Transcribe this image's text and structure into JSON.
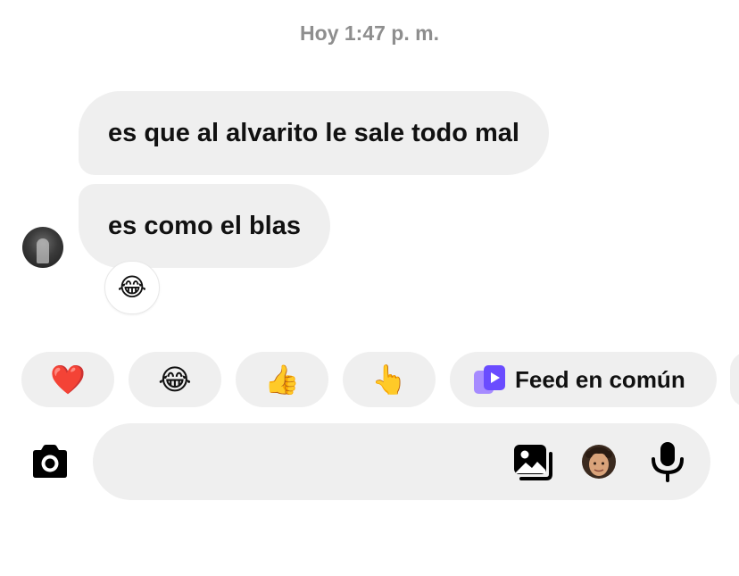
{
  "header": {
    "timestamp": "Hoy 1:47 p. m."
  },
  "messages": [
    {
      "text": "es que al alvarito le sale todo mal",
      "direction": "incoming"
    },
    {
      "text": "es como el blas",
      "direction": "incoming"
    }
  ],
  "reaction": {
    "emoji": "😂",
    "icon": "face-with-tears-of-joy-icon"
  },
  "quick_replies": {
    "items": [
      {
        "emoji": "❤️",
        "icon": "red-heart-icon"
      },
      {
        "emoji": "😂",
        "icon": "face-with-tears-of-joy-icon"
      },
      {
        "emoji": "👍",
        "icon": "thumbs-up-icon"
      },
      {
        "emoji": "👆",
        "icon": "pointing-up-icon"
      }
    ],
    "feed_label": "Feed en común"
  },
  "composer": {
    "placeholder": "",
    "icons": [
      "camera-icon",
      "gallery-icon",
      "avatar-icon",
      "microphone-icon"
    ]
  },
  "colors": {
    "bubble_bg": "#efefef",
    "timestamp": "#8e8e8e",
    "feed_icon_accent": "#7b5cff",
    "text": "#111111"
  }
}
